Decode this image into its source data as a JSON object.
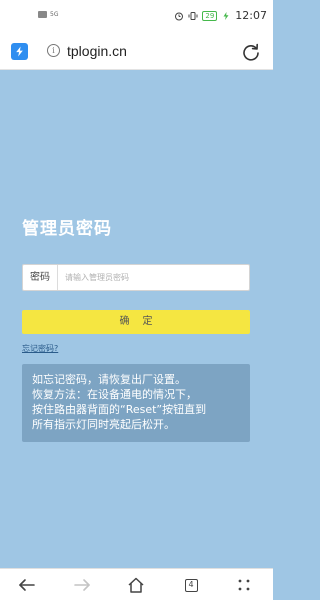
{
  "status_bar": {
    "left_text": "5G",
    "battery": "29",
    "time": "12:07"
  },
  "browser": {
    "url": "tplogin.cn",
    "tab_count": "4"
  },
  "login": {
    "title": "管理员密码",
    "password_label": "密码",
    "password_placeholder": "请输入管理员密码",
    "password_value": "",
    "confirm_button": "确定",
    "forgot_link": "忘记密码?"
  },
  "tip": {
    "lines": [
      "如忘记密码，请恢复出厂设置。",
      "恢复方法：在设备通电的情况下，",
      "按住路由器背面的“Reset”按钮直到",
      "所有指示灯同时亮起后松开。"
    ]
  },
  "icons": {
    "back": "back-arrow-icon",
    "forward": "forward-arrow-icon",
    "home": "home-icon",
    "menu": "menu-dots-icon",
    "reload": "reload-icon"
  },
  "colors": {
    "page_bg": "#9fc6e4",
    "confirm_button": "#f5e641",
    "tip_box": "#7da4c3",
    "browser_brand": "#2f8ef0"
  }
}
